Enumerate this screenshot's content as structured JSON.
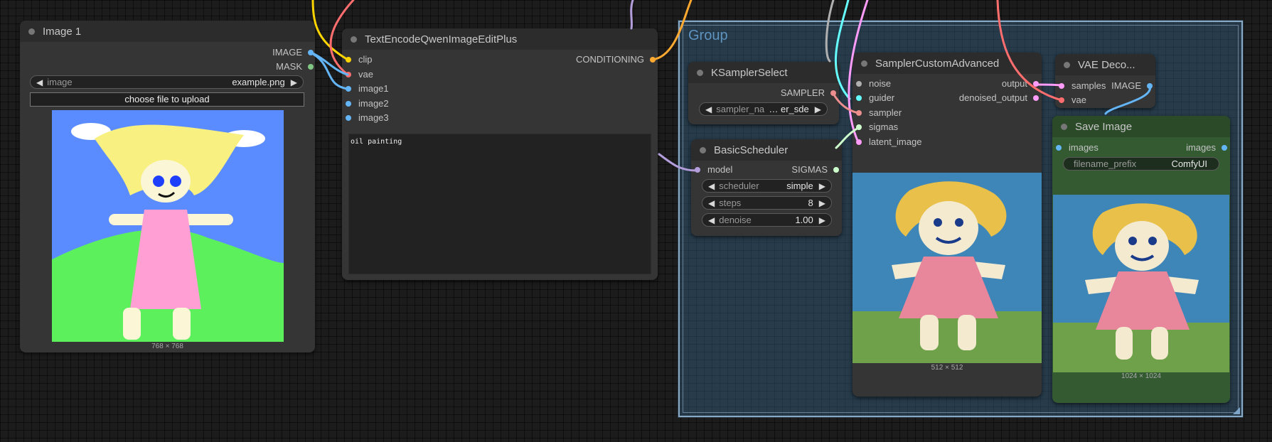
{
  "group": {
    "title": "Group"
  },
  "colors": {
    "image": "#64b5f6",
    "mask": "#81c784",
    "clip": "#ffd500",
    "vae": "#ff6e6e",
    "conditioning": "#ffa931",
    "sampler": "#ec8e8e",
    "guider": "#66ffff",
    "noise": "#b0b0b0",
    "sigmas": "#cdffcd",
    "latent": "#ff9cf9",
    "model": "#b39ddb"
  },
  "image1": {
    "title": "Image 1",
    "out_image": "IMAGE",
    "out_mask": "MASK",
    "widget_label": "image",
    "widget_value": "example.png",
    "upload": "choose file to upload",
    "caption": "768 × 768"
  },
  "text_encode": {
    "title": "TextEncodeQwenImageEditPlus",
    "inputs": [
      "clip",
      "vae",
      "image1",
      "image2",
      "image3"
    ],
    "output": "CONDITIONING",
    "prompt": "oil painting"
  },
  "ksampler_select": {
    "title": "KSamplerSelect",
    "output": "SAMPLER",
    "widget_label": "sampler_na",
    "widget_value": "… er_sde"
  },
  "basic_scheduler": {
    "title": "BasicScheduler",
    "input": "model",
    "output": "SIGMAS",
    "widgets": [
      {
        "label": "scheduler",
        "value": "simple"
      },
      {
        "label": "steps",
        "value": "8"
      },
      {
        "label": "denoise",
        "value": "1.00"
      }
    ]
  },
  "sampler_custom": {
    "title": "SamplerCustomAdvanced",
    "inputs": [
      "noise",
      "guider",
      "sampler",
      "sigmas",
      "latent_image"
    ],
    "outputs": [
      "output",
      "denoised_output"
    ],
    "caption": "512 × 512"
  },
  "vae_decode": {
    "title": "VAE Deco...",
    "inputs": [
      "samples",
      "vae"
    ],
    "output": "IMAGE"
  },
  "save_image": {
    "title": "Save Image",
    "input": "images",
    "output": "images",
    "widget_label": "filename_prefix",
    "widget_value": "ComfyUI",
    "caption": "1024 × 1024"
  }
}
